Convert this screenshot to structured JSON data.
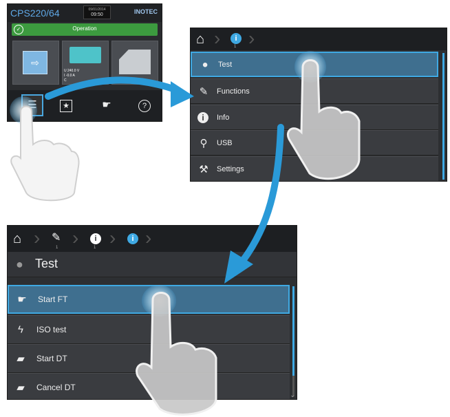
{
  "screen1": {
    "model": "CPS220/64",
    "date": "09/01/2014",
    "time": "09:50",
    "brand": "INOTEC",
    "status": "Operation",
    "readout": [
      "U  240.0  V",
      "I   -0.0  A",
      "C"
    ],
    "bar_icons": [
      "menu-icon",
      "star-icon",
      "bulb-hand-icon",
      "help-icon"
    ],
    "bar_glyphs": [
      "☰",
      "★",
      "☛",
      "?"
    ]
  },
  "screen2": {
    "crumb_num": "1",
    "items": [
      {
        "label": "Test",
        "icon": "bulb-icon",
        "glyph": "●"
      },
      {
        "label": "Functions",
        "icon": "functions-icon",
        "glyph": "✎"
      },
      {
        "label": "Info",
        "icon": "info-icon",
        "glyph": "i"
      },
      {
        "label": "USB",
        "icon": "usb-icon",
        "glyph": "⚲"
      },
      {
        "label": "Settings",
        "icon": "settings-icon",
        "glyph": "⚒"
      }
    ]
  },
  "screen3": {
    "crumb_nums": [
      "1",
      "1"
    ],
    "title": "Test",
    "items": [
      {
        "label": "Start FT",
        "icon": "bulb-hand-icon",
        "glyph": "☛"
      },
      {
        "label": "ISO test",
        "icon": "iso-test-icon",
        "glyph": "ϟ"
      },
      {
        "label": "Start DT",
        "icon": "battery-start-icon",
        "glyph": "▰"
      },
      {
        "label": "Cancel DT",
        "icon": "battery-cancel-icon",
        "glyph": "▰"
      }
    ]
  },
  "colors": {
    "accent": "#3fa9e3",
    "status_green": "#3c9b3f",
    "arrow": "#2a9ad8"
  }
}
